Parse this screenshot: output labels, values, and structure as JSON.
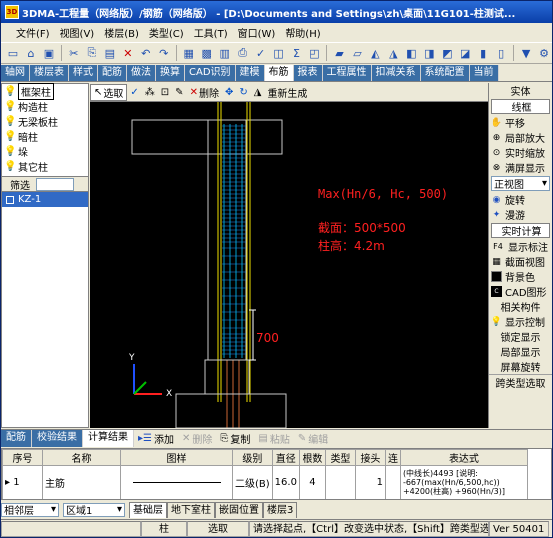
{
  "window": {
    "title": "3DMA-工程量（网络版）/钢筋（网络版） - [D:\\Documents and Settings\\zh\\桌面\\11G101-柱测试..."
  },
  "menu": [
    "文件(F)",
    "视图(V)",
    "楼层(B)",
    "类型(C)",
    "工具(T)",
    "窗口(W)",
    "帮助(H)"
  ],
  "tabs": [
    "轴网",
    "楼层表",
    "样式",
    "配筋",
    "做法",
    "换算",
    "CAD识别",
    "建模",
    "布筋",
    "报表",
    "工程属性",
    "扣减关系",
    "系统配置",
    "当前"
  ],
  "active_tab": "布筋",
  "left_panel": {
    "items": [
      "框架柱",
      "构造柱",
      "无梁板柱",
      "暗柱",
      "垛",
      "其它柱"
    ],
    "selected": "框架柱",
    "filter_label": "筛选",
    "components": [
      "KZ-1"
    ]
  },
  "draw_toolbar": {
    "select": "选取",
    "delete": "删除",
    "regenerate": "重新生成"
  },
  "canvas": {
    "formula": "Max(Hn/6, Hc, 500)",
    "section": "截面：500*500",
    "height": "柱高：4.2m",
    "dim": "700",
    "axis_y": "Y",
    "axis_x": "X"
  },
  "right_panel": {
    "entity": "实体",
    "wireframe": "线框",
    "pan": "平移",
    "zoom_local": "局部放大",
    "zoom_realtime": "实时缩放",
    "fit": "满屏显示",
    "view": "正视图",
    "rotate": "旋转",
    "roam": "漫游",
    "realtime_calc": "实时计算",
    "f4": "F4",
    "show_label": "显示标注",
    "section_view": "截面视图",
    "bgcolor": "背景色",
    "cad": "CAD图形",
    "related": "相关构件",
    "show_ctrl": "显示控制",
    "lock_show": "锁定显示",
    "local_show": "局部显示",
    "screen_rotate": "屏幕旋转",
    "cross_type": "跨类型选取"
  },
  "bottom_tabs": [
    "配筋",
    "校验结果",
    "计算结果"
  ],
  "active_bottom_tab": "计算结果",
  "bottom_actions": {
    "add": "添加",
    "delete": "删除",
    "copy": "复制",
    "paste": "粘贴",
    "edit": "编辑"
  },
  "grid": {
    "headers": [
      "序号",
      "名称",
      "图样",
      "级别",
      "直径",
      "根数",
      "类型",
      "接头",
      "连",
      "表达式"
    ],
    "rows": [
      {
        "no": "1",
        "name": "主筋",
        "level": "二级(B)",
        "dia": "16.0",
        "count": "4",
        "type": "",
        "joint": "1",
        "conn": "",
        "expr": "(中线长)4493 [说明: -667(max(Hn/6,500,hc)) +4200(柱高) +960(Hn/3)]"
      }
    ]
  },
  "floor_bar": {
    "label": "相邻层",
    "combo": "区域1",
    "floors": [
      "基础层",
      "地下室柱",
      "嵌固位置",
      "楼层3"
    ],
    "active_floor": "基础层"
  },
  "status": {
    "item": "柱",
    "mode": "选取",
    "hint": "请选择起点,【Ctrl】改变选中状态,【Shift】跨类型选择",
    "version": "Ver 50401"
  }
}
